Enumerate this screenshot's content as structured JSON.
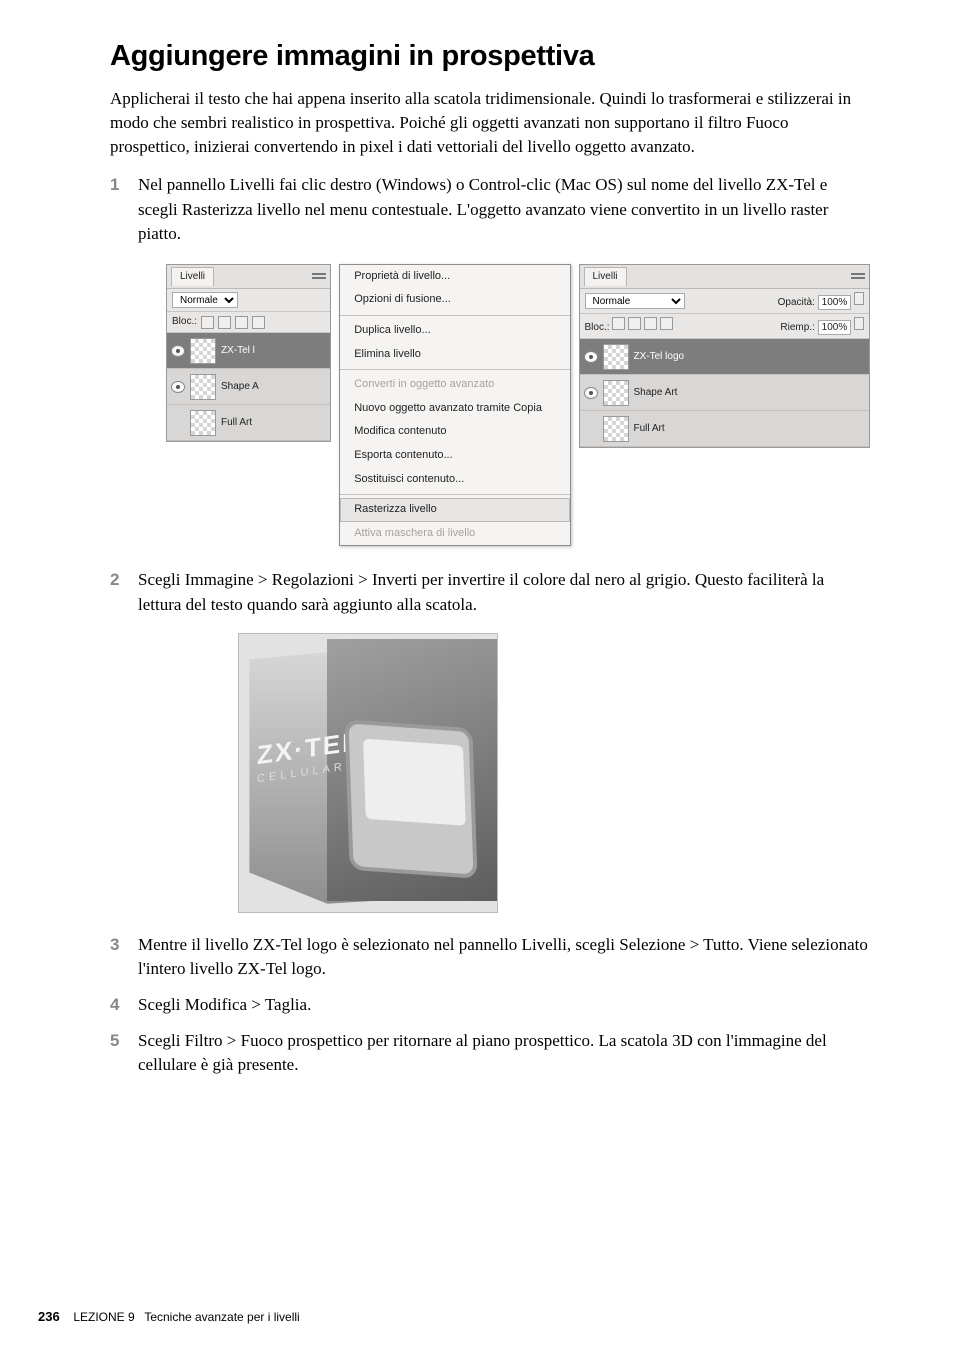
{
  "heading": "Aggiungere immagini in prospettiva",
  "intro": "Applicherai il testo che hai appena inserito alla scatola tridimensionale. Quindi lo trasformerai e stilizzerai in modo che sembri realistico in prospettiva. Poiché gli oggetti avanzati non supportano il filtro Fuoco prospettico, inizierai convertendo in pixel i dati vettoriali del livello oggetto avanzato.",
  "steps": {
    "s1": "Nel pannello Livelli fai clic destro (Windows) o Control-clic (Mac OS) sul nome del livello ZX-Tel e scegli Rasterizza livello nel menu contestuale. L'oggetto avanzato viene convertito in un livello raster piatto.",
    "s2": "Scegli Immagine > Regolazioni > Inverti per invertire il colore dal nero al grigio. Questo faciliterà la lettura del testo quando sarà aggiunto alla scatola.",
    "s3": "Mentre il livello ZX-Tel logo è selezionato nel pannello Livelli, scegli Selezione > Tutto. Viene selezionato l'intero livello ZX-Tel logo.",
    "s4": "Scegli Modifica > Taglia.",
    "s5": "Scegli Filtro > Fuoco prospettico per ritornare al piano prospettico. La scatola 3D con l'immagine del cellulare è già presente."
  },
  "panel_left": {
    "tab": "Livelli",
    "mode": "Normale",
    "lock_label": "Bloc.:",
    "layers": [
      "ZX-Tel l",
      "Shape A",
      "Full Art"
    ]
  },
  "context_menu": {
    "items": [
      "Proprietà di livello...",
      "Opzioni di fusione...",
      "Duplica livello...",
      "Elimina livello",
      "Converti in oggetto avanzato",
      "Nuovo oggetto avanzato tramite Copia",
      "Modifica contenuto",
      "Esporta contenuto...",
      "Sostituisci contenuto...",
      "Rasterizza livello",
      "Attiva maschera di livello"
    ]
  },
  "panel_right": {
    "tab": "Livelli",
    "mode": "Normale",
    "opacity_label": "Opacità:",
    "opacity_value": "100%",
    "lock_label": "Bloc.:",
    "fill_label": "Riemp.:",
    "fill_value": "100%",
    "layers": [
      "ZX-Tel logo",
      "Shape Art",
      "Full Art"
    ]
  },
  "product_logo": {
    "l1": "ZX·TEL",
    "l2": "CELLULAR"
  },
  "footer": {
    "page": "236",
    "lesson": "LEZIONE 9",
    "title": "Tecniche avanzate per i livelli"
  }
}
